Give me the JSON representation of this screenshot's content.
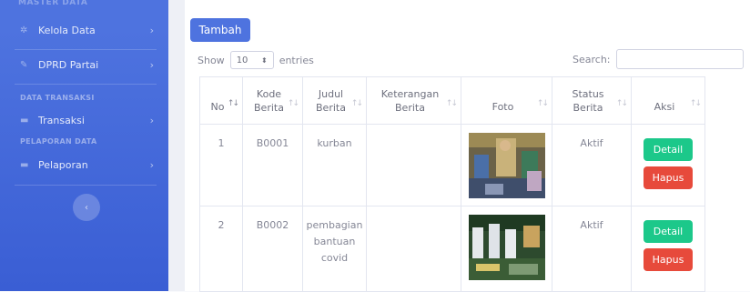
{
  "sidebar": {
    "cut_heading": "MASTER DATA",
    "items": [
      {
        "label": "Kelola Data",
        "icon": "gear-icon"
      },
      {
        "label": "DPRD Partai",
        "icon": "wrench-icon"
      }
    ],
    "heading_transaksi": "DATA TRANSAKSI",
    "transaksi": {
      "label": "Transaksi",
      "icon": "folder-icon"
    },
    "heading_pelaporan": "PELAPORAN DATA",
    "pelaporan": {
      "label": "Pelaporan",
      "icon": "folder-icon"
    },
    "toggle_icon": "chevron-left-icon"
  },
  "toolbar": {
    "add_label": "Tambah",
    "show_label": "Show",
    "entries_value": "10",
    "entries_label": "entries",
    "search_label": "Search:",
    "search_value": ""
  },
  "table": {
    "columns": [
      {
        "line1": "No",
        "line2": ""
      },
      {
        "line1": "Kode",
        "line2": "Berita"
      },
      {
        "line1": "Judul",
        "line2": "Berita"
      },
      {
        "line1": "Keterangan",
        "line2": "Berita"
      },
      {
        "line1": "Foto",
        "line2": ""
      },
      {
        "line1": "Status",
        "line2": "Berita"
      },
      {
        "line1": "Aksi",
        "line2": ""
      }
    ],
    "rows": [
      {
        "no": "1",
        "kode": "B0001",
        "judul": [
          "kurban"
        ],
        "keterangan": "",
        "status": "Aktif",
        "detail_label": "Detail",
        "hapus_label": "Hapus"
      },
      {
        "no": "2",
        "kode": "B0002",
        "judul": [
          "pembagian",
          "bantuan",
          "covid"
        ],
        "keterangan": "",
        "status": "Aktif",
        "detail_label": "Detail",
        "hapus_label": "Hapus"
      }
    ]
  },
  "colors": {
    "primary": "#4e73df",
    "success": "#1cc88a",
    "danger": "#e74a3b"
  }
}
